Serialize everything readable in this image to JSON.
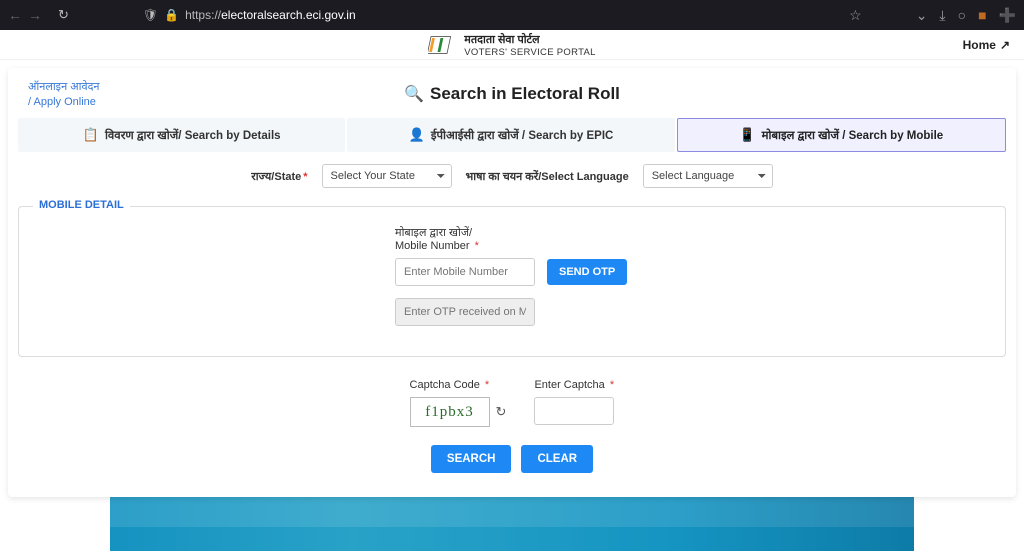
{
  "browser": {
    "url_prefix": "https://",
    "url_host": "electoralsearch.eci.gov.in"
  },
  "header": {
    "title_hi": "मतदाता सेवा पोर्टल",
    "title_en": "VOTERS' SERVICE PORTAL",
    "home_label": "Home"
  },
  "side_link": {
    "line1": "ऑनलाइन आवेदन",
    "line2": "/ Apply Online"
  },
  "page_title": "Search in Electoral Roll",
  "tabs": {
    "details": "विवरण द्वारा खोजें/ Search by Details",
    "epic": "ईपीआईसी द्वारा खोजें / Search by EPIC",
    "mobile": "मोबाइल द्वारा खोजें / Search by Mobile"
  },
  "selectors": {
    "state_label": "राज्य/State",
    "state_placeholder": "Select Your State",
    "lang_label": "भाषा का चयन करें/Select Language",
    "lang_placeholder": "Select Language"
  },
  "mobile_detail": {
    "legend": "MOBILE DETAIL",
    "label_hi": "मोबाइल द्वारा खोजें/",
    "label_en": "Mobile Number",
    "mobile_placeholder": "Enter Mobile Number",
    "send_otp": "SEND OTP",
    "otp_placeholder": "Enter OTP received on Mobile"
  },
  "captcha": {
    "code_label": "Captcha Code",
    "code_value": "f1pbx3",
    "enter_label": "Enter Captcha"
  },
  "actions": {
    "search": "SEARCH",
    "clear": "CLEAR"
  }
}
